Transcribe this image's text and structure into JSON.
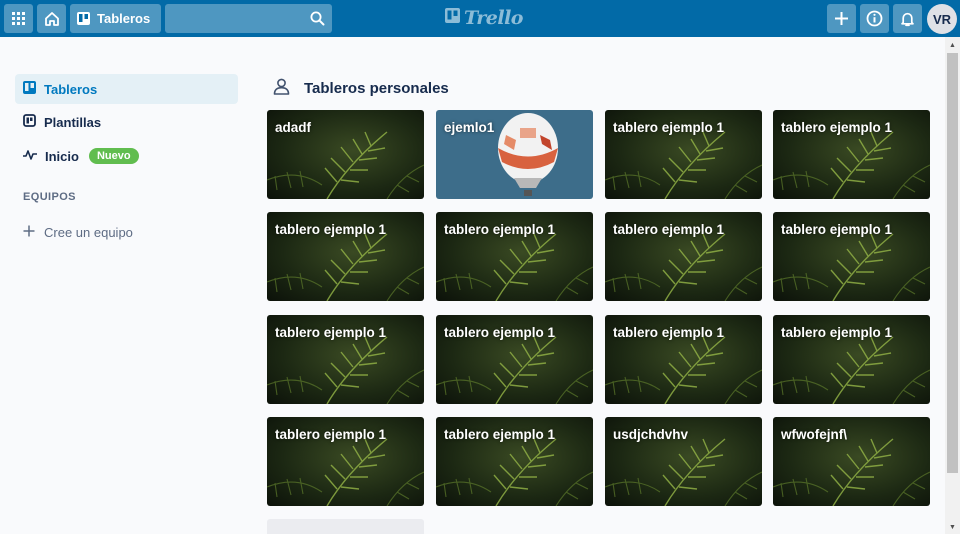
{
  "header": {
    "boards_label": "Tableros",
    "search_value": "",
    "logo_text": "Trello",
    "avatar_initials": "VR"
  },
  "sidebar": {
    "items": [
      {
        "label": "Tableros",
        "icon": "board-icon"
      },
      {
        "label": "Plantillas",
        "icon": "templates-icon"
      },
      {
        "label": "Inicio",
        "icon": "activity-icon",
        "badge": "Nuevo"
      }
    ],
    "teams_heading": "EQUIPOS",
    "create_team": "Cree un equipo"
  },
  "main": {
    "section_title": "Tableros personales",
    "boards": [
      {
        "title": "adadf",
        "background": "palm"
      },
      {
        "title": "ejemlo1",
        "background": "balloon"
      },
      {
        "title": "tablero ejemplo 1",
        "background": "palm"
      },
      {
        "title": "tablero ejemplo 1",
        "background": "palm"
      },
      {
        "title": "tablero ejemplo 1",
        "background": "palm"
      },
      {
        "title": "tablero ejemplo 1",
        "background": "palm"
      },
      {
        "title": "tablero ejemplo 1",
        "background": "palm"
      },
      {
        "title": "tablero ejemplo 1",
        "background": "palm"
      },
      {
        "title": "tablero ejemplo 1",
        "background": "palm"
      },
      {
        "title": "tablero ejemplo 1",
        "background": "palm"
      },
      {
        "title": "tablero ejemplo 1",
        "background": "palm"
      },
      {
        "title": "tablero ejemplo 1",
        "background": "palm"
      },
      {
        "title": "tablero ejemplo 1",
        "background": "palm"
      },
      {
        "title": "tablero ejemplo 1",
        "background": "palm"
      },
      {
        "title": "usdjchdvhv",
        "background": "palm"
      },
      {
        "title": "wfwofejnf\\",
        "background": "palm"
      }
    ]
  },
  "colors": {
    "header": "#026aa7",
    "active_nav": "#0079bf",
    "badge": "#61bd4f"
  }
}
